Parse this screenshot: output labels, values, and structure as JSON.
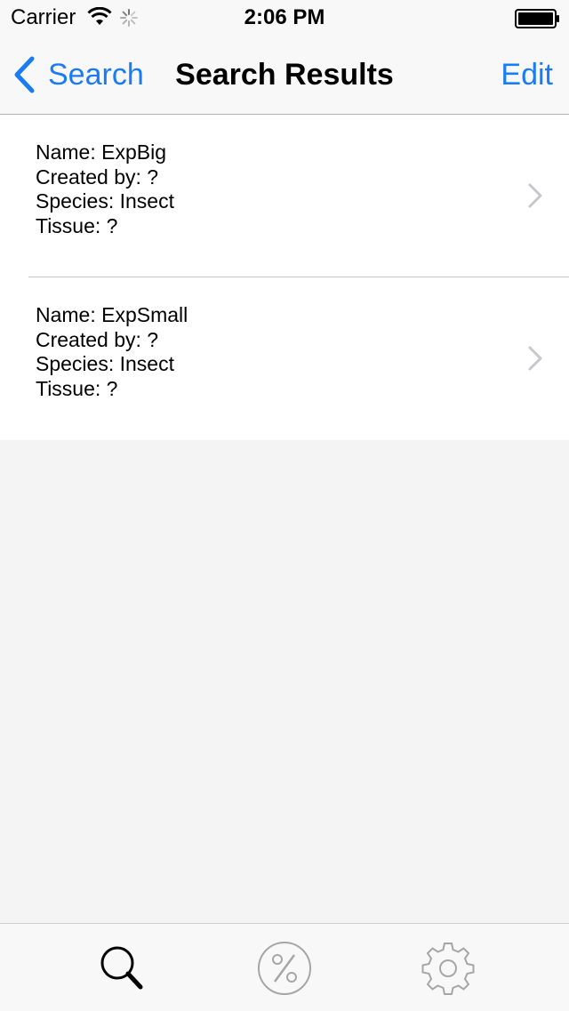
{
  "status_bar": {
    "carrier": "Carrier",
    "time": "2:06 PM",
    "icons": [
      "wifi-icon",
      "activity-spinner-icon",
      "battery-icon"
    ]
  },
  "nav_bar": {
    "back_label": "Search",
    "title": "Search Results",
    "edit_label": "Edit",
    "accent_color": "#1a7cf5"
  },
  "results": [
    {
      "name": "Name: ExpBig",
      "created_by": "Created by: ?",
      "species": "Species: Insect",
      "tissue": "Tissue: ?"
    },
    {
      "name": "Name: ExpSmall",
      "created_by": "Created by: ?",
      "species": "Species: Insect",
      "tissue": "Tissue: ?"
    }
  ],
  "tab_bar": {
    "tabs": [
      {
        "icon": "search-icon",
        "selected": true
      },
      {
        "icon": "percent-icon",
        "selected": false
      },
      {
        "icon": "gear-icon",
        "selected": false
      }
    ]
  }
}
